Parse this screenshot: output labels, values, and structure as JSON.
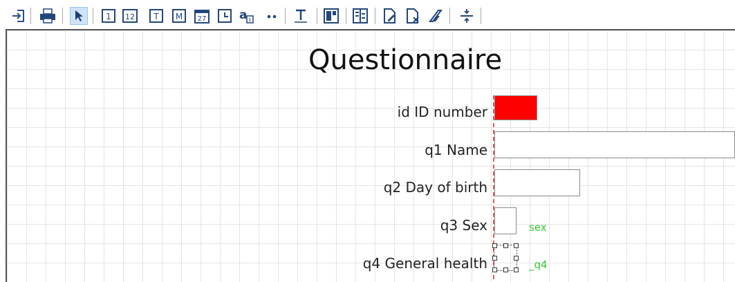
{
  "toolbar": {
    "buttons": [
      {
        "name": "exit-icon",
        "glyph": "⇥"
      },
      {
        "name": "print-icon",
        "glyph": "🖶"
      },
      {
        "name": "pointer-icon",
        "glyph": "↖",
        "active": true
      },
      {
        "name": "number-field-icon",
        "glyph": "1"
      },
      {
        "name": "number-12-field-icon",
        "glyph": "12"
      },
      {
        "name": "text-field-icon",
        "glyph": "T"
      },
      {
        "name": "memo-field-icon",
        "glyph": "M"
      },
      {
        "name": "date-field-icon",
        "glyph": "27"
      },
      {
        "name": "time-field-icon",
        "glyph": "◔"
      },
      {
        "name": "label-field-icon",
        "glyph": "a"
      },
      {
        "name": "dots-icon",
        "glyph": "••"
      },
      {
        "name": "text-tool-icon",
        "glyph": "T"
      },
      {
        "name": "box-icon",
        "glyph": "▣"
      },
      {
        "name": "align-icon",
        "glyph": "⫶"
      },
      {
        "name": "edit-field-icon",
        "glyph": "✎"
      },
      {
        "name": "delete-field-icon",
        "glyph": "✕"
      },
      {
        "name": "eraser-icon",
        "glyph": "⌫"
      },
      {
        "name": "split-icon",
        "glyph": "÷"
      }
    ]
  },
  "form": {
    "title": "Questionnaire",
    "fields": [
      {
        "label": "id ID number",
        "var": ""
      },
      {
        "label": "q1 Name",
        "var": ""
      },
      {
        "label": "q2 Day of birth",
        "var": ""
      },
      {
        "label": "q3 Sex",
        "var": "sex"
      },
      {
        "label": "q4 General health",
        "var": "_q4"
      }
    ]
  },
  "colors": {
    "selected_field": "#ff0000",
    "var_name": "#33cc33",
    "guide": "#e35b5b"
  }
}
